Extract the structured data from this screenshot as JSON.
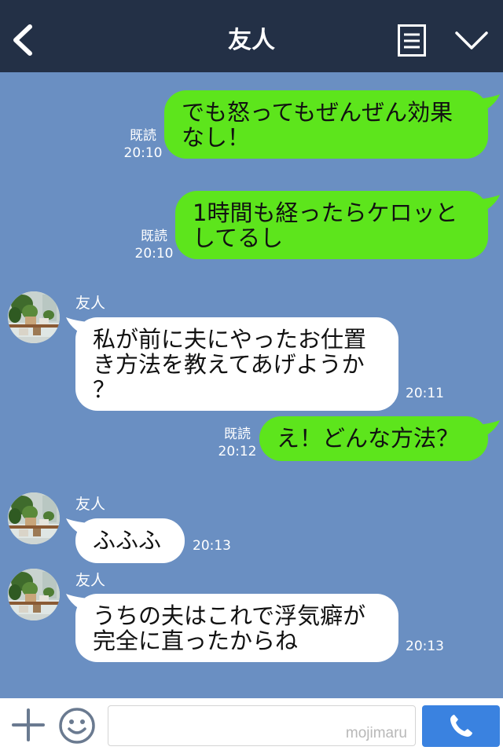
{
  "header": {
    "title": "友人",
    "back_icon": "chevron-left-icon",
    "menu_icon": "document-list-icon",
    "collapse_icon": "chevron-down-icon"
  },
  "messages": [
    {
      "direction": "sent",
      "line1": "でも怒ってもぜんぜん効果",
      "line2": "なし！",
      "read": "既読",
      "time": "20:10"
    },
    {
      "direction": "sent",
      "line1": "1時間も経ったらケロッと",
      "line2": "してるし",
      "read": "既読",
      "time": "20:10"
    },
    {
      "direction": "received",
      "sender": "友人",
      "line1": "私が前に夫にやったお仕置",
      "line2": "き方法を教えてあげようか",
      "line3": "？",
      "time": "20:11"
    },
    {
      "direction": "sent",
      "line1": "え！どんな方法？",
      "read": "既読",
      "time": "20:12"
    },
    {
      "direction": "received",
      "sender": "友人",
      "line1": "ふふふ",
      "time": "20:13"
    },
    {
      "direction": "received",
      "sender": "友人",
      "line1": "うちの夫はこれで浮気癖が",
      "line2": "完全に直ったからね",
      "time": "20:13"
    }
  ],
  "footer": {
    "input_value": "",
    "watermark": "mojimaru",
    "plus_icon": "plus-icon",
    "emoji_icon": "smiley-icon",
    "call_icon": "phone-icon"
  },
  "colors": {
    "header_bg": "#233046",
    "chat_bg": "#6a8fc2",
    "sent_bubble": "#5de51c",
    "received_bubble": "#ffffff",
    "call_button": "#3a82e0"
  }
}
